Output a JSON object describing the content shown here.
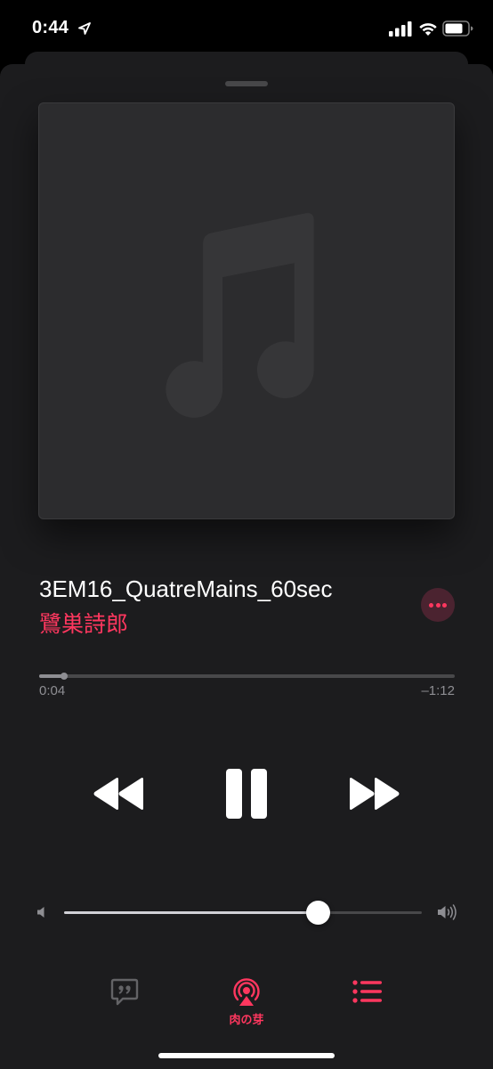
{
  "status_bar": {
    "time": "0:44",
    "icons": [
      "location-arrow-icon",
      "signal-icon",
      "wifi-icon",
      "battery-icon"
    ]
  },
  "artwork": {
    "icon": "music-note-icon"
  },
  "track": {
    "title": "3EM16_QuatreMains_60sec",
    "artist": "鷺巣詩郎",
    "more_icon": "ellipsis-icon"
  },
  "progress": {
    "elapsed": "0:04",
    "remaining": "–1:12",
    "fraction": 0.06
  },
  "controls": {
    "rewind_icon": "rewind-icon",
    "pause_icon": "pause-icon",
    "forward_icon": "fast-forward-icon"
  },
  "volume": {
    "level": 0.71,
    "low_icon": "speaker-low-icon",
    "high_icon": "speaker-high-icon"
  },
  "bottom_bar": {
    "lyrics_icon": "lyrics-quote-icon",
    "airplay_icon": "airplay-audio-icon",
    "airplay_label": "肉の芽",
    "queue_icon": "up-next-list-icon"
  },
  "colors": {
    "accent": "#ff375f",
    "background": "#1c1c1e",
    "artwork_bg": "#2c2c2e",
    "secondary_text": "#8e8e93"
  }
}
